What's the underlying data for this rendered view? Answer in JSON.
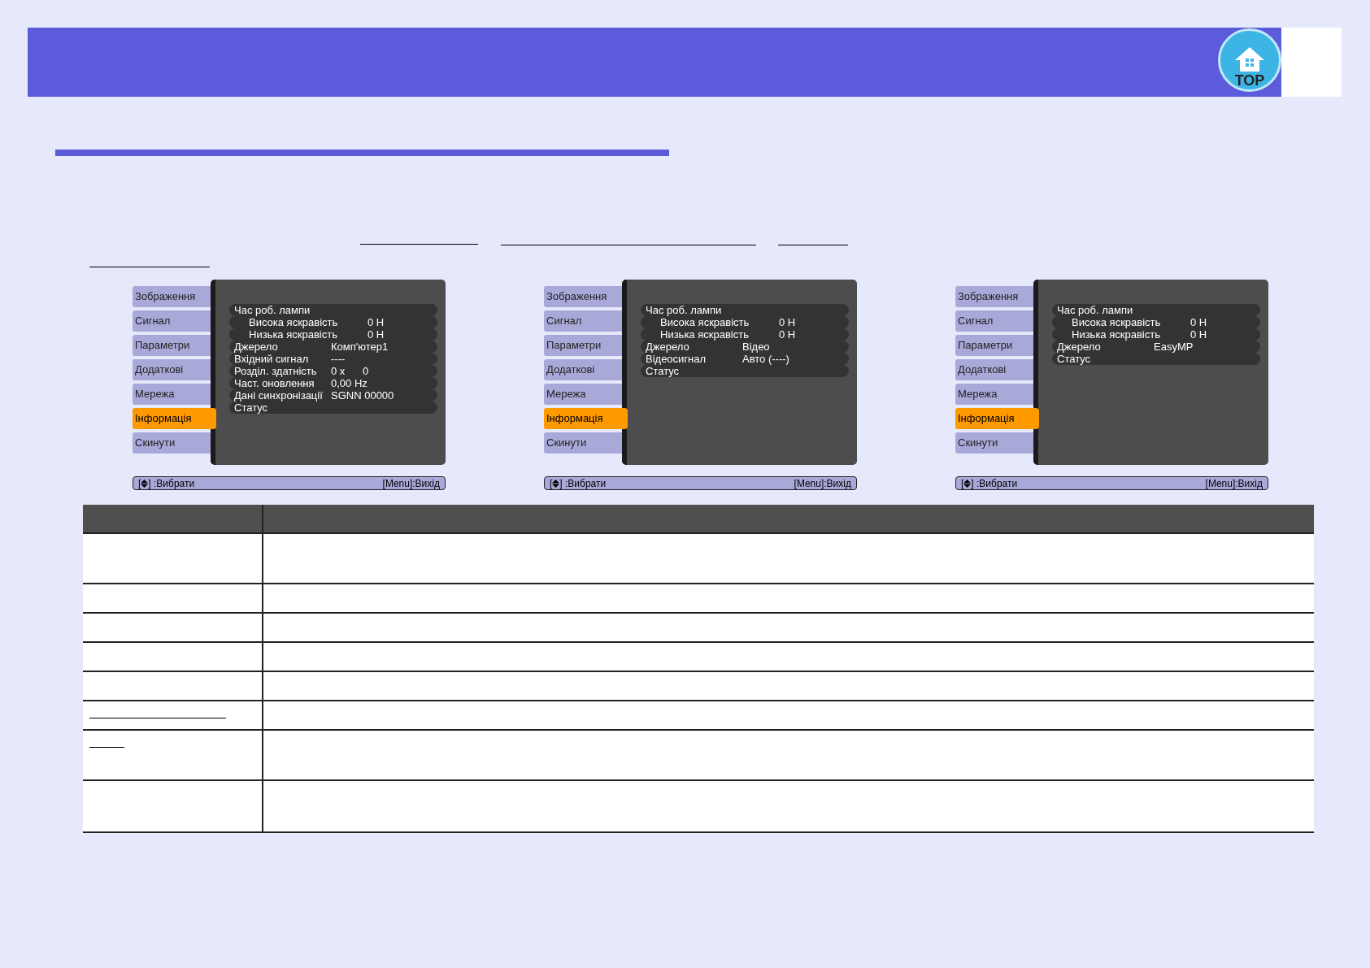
{
  "header": {
    "logo_text": "TOP"
  },
  "menus": [
    {
      "tabs": [
        {
          "label": "Зображення",
          "selected": false
        },
        {
          "label": "Сигнал",
          "selected": false
        },
        {
          "label": "Параметри",
          "selected": false
        },
        {
          "label": "Додаткові",
          "selected": false
        },
        {
          "label": "Мережа",
          "selected": false
        },
        {
          "label": "Інформація",
          "selected": true
        },
        {
          "label": "Скинути",
          "selected": false
        }
      ],
      "rows": [
        {
          "label": "Час роб. лампи",
          "children": [
            {
              "label": "Висока яскравість",
              "value": "0 H"
            },
            {
              "label": "Низька яскравість",
              "value": "0 H"
            }
          ]
        },
        {
          "label": "Джерело",
          "value": "Комп'ютер1"
        },
        {
          "label": "Вхідний сигнал",
          "value": "----"
        },
        {
          "label": "Розділ. здатність",
          "value": "0 x      0"
        },
        {
          "label": "Част. оновлення",
          "value": "0,00 Hz"
        },
        {
          "label": "Дані синхронізації",
          "value": "SGNN 00000"
        },
        {
          "label": "Статус"
        }
      ],
      "footer": {
        "open": "[",
        "select": "] :Вибрати",
        "exit": "[Menu]:Вихід"
      }
    },
    {
      "tabs": [
        {
          "label": "Зображення",
          "selected": false
        },
        {
          "label": "Сигнал",
          "selected": false
        },
        {
          "label": "Параметри",
          "selected": false
        },
        {
          "label": "Додаткові",
          "selected": false
        },
        {
          "label": "Мережа",
          "selected": false
        },
        {
          "label": "Інформація",
          "selected": true
        },
        {
          "label": "Скинути",
          "selected": false
        }
      ],
      "rows": [
        {
          "label": "Час роб. лампи",
          "children": [
            {
              "label": "Висока яскравість",
              "value": "0 H"
            },
            {
              "label": "Низька яскравість",
              "value": "0 H"
            }
          ]
        },
        {
          "label": "Джерело",
          "value": "Відео"
        },
        {
          "label": "Відеосигнал",
          "value": "Авто (----)"
        },
        {
          "label": "Статус"
        }
      ],
      "footer": {
        "open": "[",
        "select": "] :Вибрати",
        "exit": "[Menu]:Вихід"
      }
    },
    {
      "tabs": [
        {
          "label": "Зображення",
          "selected": false
        },
        {
          "label": "Сигнал",
          "selected": false
        },
        {
          "label": "Параметри",
          "selected": false
        },
        {
          "label": "Додаткові",
          "selected": false
        },
        {
          "label": "Мережа",
          "selected": false
        },
        {
          "label": "Інформація",
          "selected": true
        },
        {
          "label": "Скинути",
          "selected": false
        }
      ],
      "rows": [
        {
          "label": "Час роб. лампи",
          "children": [
            {
              "label": "Висока яскравість",
              "value": "0 H"
            },
            {
              "label": "Низька яскравість",
              "value": "0 H"
            }
          ]
        },
        {
          "label": "Джерело",
          "value": "EasyMP"
        },
        {
          "label": "Статус"
        }
      ],
      "footer": {
        "open": "[",
        "select": "] :Вибрати",
        "exit": "[Menu]:Вихід"
      }
    }
  ]
}
